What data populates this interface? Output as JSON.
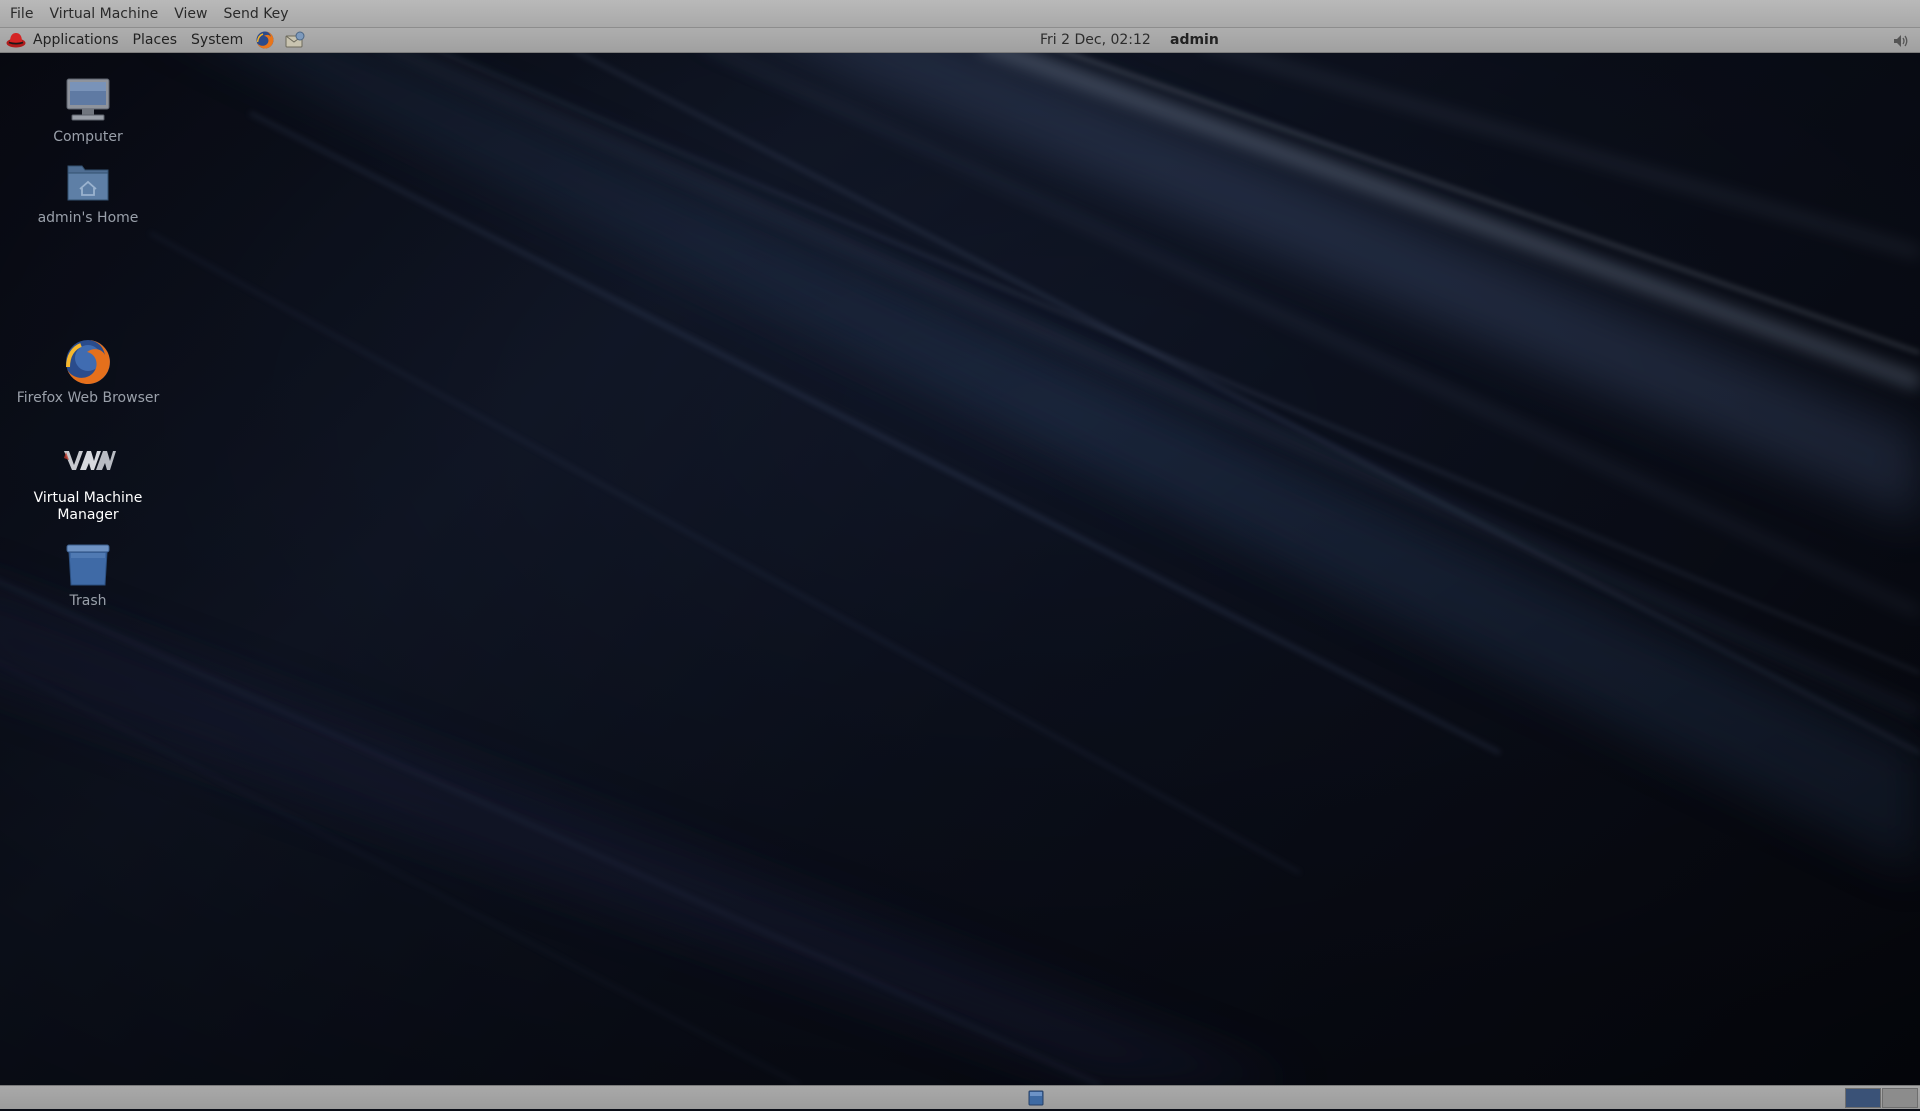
{
  "viewer_menu": {
    "items": [
      "File",
      "Virtual Machine",
      "View",
      "Send Key"
    ]
  },
  "top_panel": {
    "menus": [
      "Applications",
      "Places",
      "System"
    ],
    "launchers": [
      "firefox-icon",
      "mail-icon"
    ],
    "clock": "Fri  2 Dec, 02:12",
    "user": "admin",
    "volume_icon": "volume-icon"
  },
  "desktop": {
    "icons": [
      {
        "label": "Computer",
        "icon": "computer-icon"
      },
      {
        "label": "admin's Home",
        "icon": "home-folder-icon"
      },
      {
        "label": "Firefox Web Browser",
        "icon": "firefox-icon"
      },
      {
        "label": "Virtual Machine Manager",
        "icon": "virt-manager-icon",
        "selected": true
      },
      {
        "label": "Trash",
        "icon": "trash-icon"
      }
    ]
  },
  "bottom_panel": {
    "show_desktop_icon": "show-desktop-icon",
    "workspaces": [
      {
        "name": "workspace-1",
        "active": true
      },
      {
        "name": "workspace-2",
        "active": false
      }
    ]
  },
  "colors": {
    "panel": "#a6a6a6",
    "desktop_dark": "#0a0d16",
    "active_workspace": "#3a5277"
  }
}
